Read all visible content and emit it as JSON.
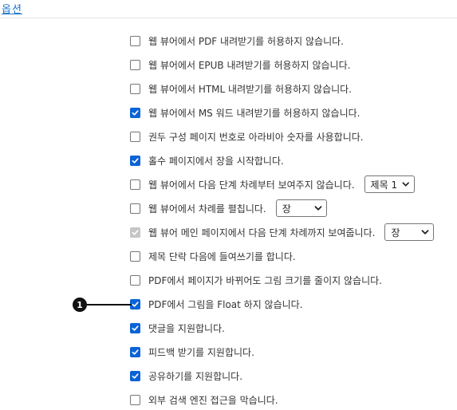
{
  "header": {
    "title": "옵션"
  },
  "options": [
    {
      "label": "웹 뷰어에서 PDF 내려받기를 허용하지 않습니다.",
      "checked": false
    },
    {
      "label": "웹 뷰어에서 EPUB 내려받기를 허용하지 않습니다.",
      "checked": false
    },
    {
      "label": "웹 뷰어에서 HTML 내려받기를 허용하지 않습니다.",
      "checked": false
    },
    {
      "label": "웹 뷰어에서 MS 워드 내려받기를 허용하지 않습니다.",
      "checked": true
    },
    {
      "label": "권두 구성 페이지 번호로 아라비아 숫자를 사용합니다.",
      "checked": false
    },
    {
      "label": "홀수 페이지에서 장을 시작합니다.",
      "checked": true
    },
    {
      "label": "웹 뷰어에서 다음 단계 차례부터 보여주지 않습니다.",
      "checked": false,
      "select_value": "제목 1"
    },
    {
      "label": "웹 뷰어에서 차례를 펼칩니다.",
      "checked": false,
      "select_value": "장"
    },
    {
      "label": "웹 뷰어 메인 페이지에서 다음 단계 차례까지 보여줍니다.",
      "checked": true,
      "disabled": true,
      "select_value": "장"
    },
    {
      "label": "제목 단락 다음에 들여쓰기를 합니다.",
      "checked": false
    },
    {
      "label": "PDF에서 페이지가 바뀌어도 그림 크기를 줄이지 않습니다.",
      "checked": false
    },
    {
      "label": "PDF에서 그림을 Float 하지 않습니다.",
      "checked": true
    },
    {
      "label": "댓글을 지원합니다.",
      "checked": true
    },
    {
      "label": "피드백 받기를 지원합니다.",
      "checked": true
    },
    {
      "label": "공유하기를 지원합니다.",
      "checked": true
    },
    {
      "label": "외부 검색 엔진 접근을 막습니다.",
      "checked": false
    }
  ],
  "annotation": {
    "marker_label": "1"
  },
  "colors": {
    "accent": "#0b63d6",
    "link": "#1a73c8",
    "disabled": "#c6c6c6",
    "marker": "#111111"
  },
  "icons": {
    "checkbox_check": "check-icon",
    "select_arrow": "chevron-down-icon"
  }
}
